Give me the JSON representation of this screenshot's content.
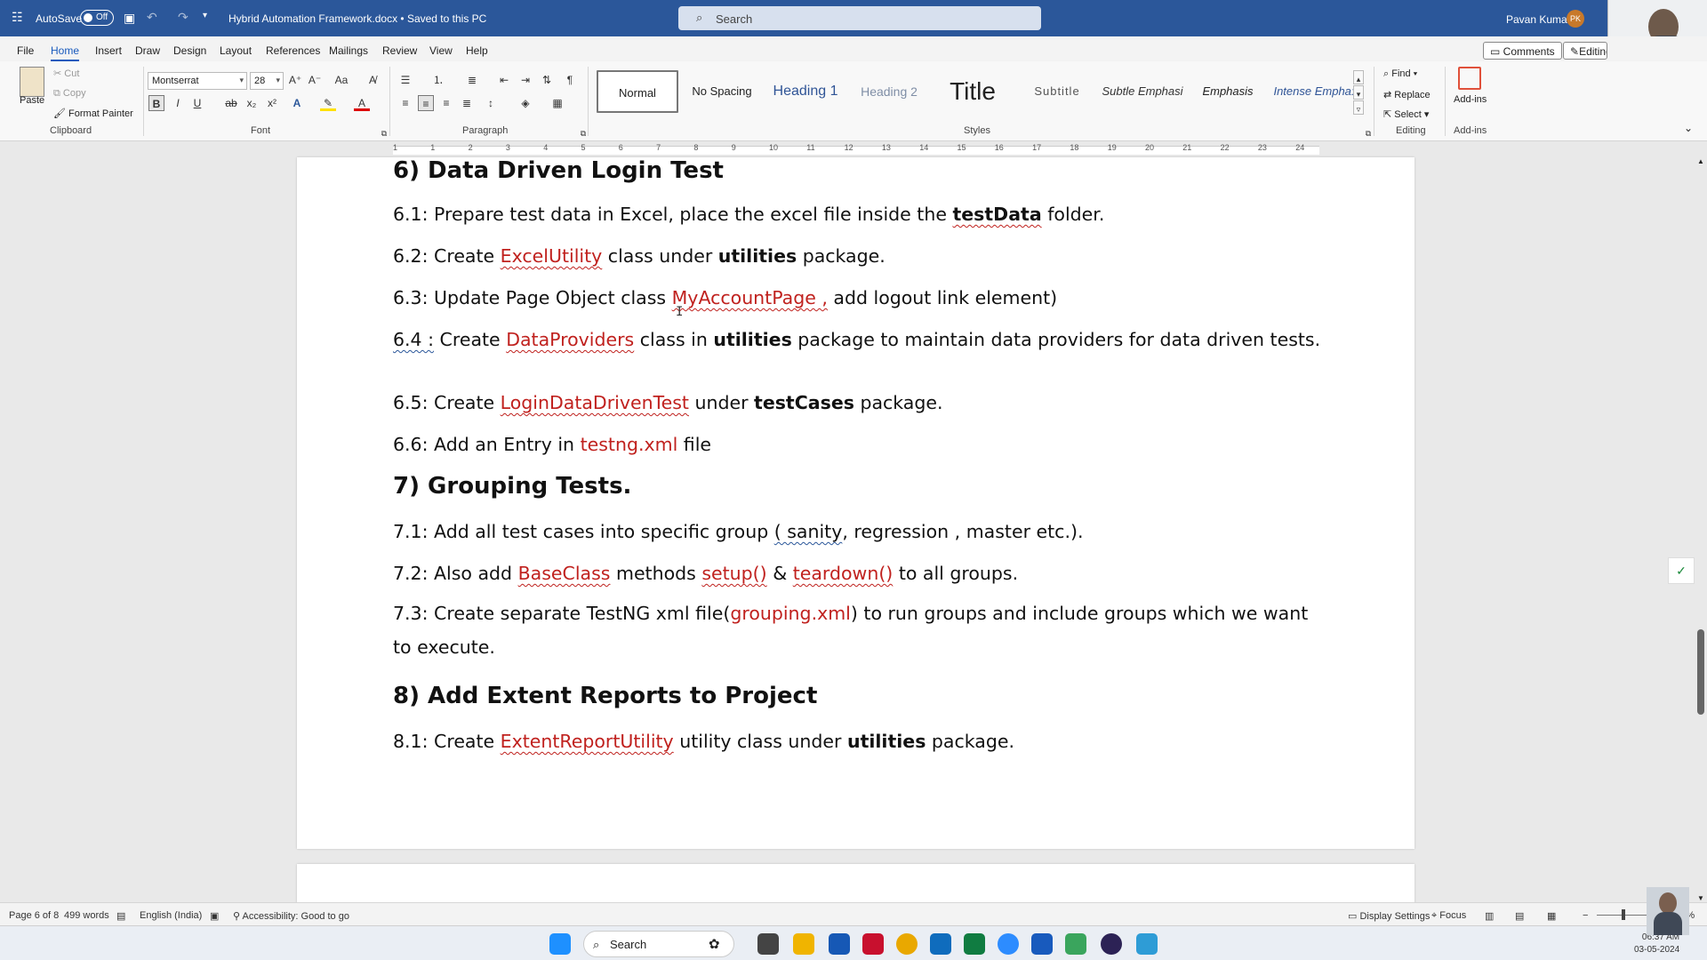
{
  "titlebar": {
    "autosave_label": "AutoSave",
    "autosave_state": "Off",
    "doc_title": "Hybrid Automation Framework.docx • Saved to this PC",
    "search_placeholder": "Search",
    "user_name": "Pavan Kumar",
    "user_initials": "PK"
  },
  "menu": {
    "items": [
      "File",
      "Home",
      "Insert",
      "Draw",
      "Design",
      "Layout",
      "References",
      "Mailings",
      "Review",
      "View",
      "Help"
    ],
    "active": "Home",
    "comments_label": "Comments",
    "editing_label": "Editing"
  },
  "ribbon": {
    "clipboard": {
      "paste": "Paste",
      "cut": "Cut",
      "copy": "Copy",
      "format_painter": "Format Painter",
      "group_label": "Clipboard"
    },
    "font": {
      "font_name": "Montserrat",
      "font_size": "28",
      "group_label": "Font"
    },
    "paragraph": {
      "group_label": "Paragraph"
    },
    "styles": {
      "items": [
        "Normal",
        "No Spacing",
        "Heading 1",
        "Heading 2",
        "Title",
        "Subtitle",
        "Subtle Emphasi",
        "Emphasis",
        "Intense Empha:"
      ],
      "selected": "Normal",
      "group_label": "Styles"
    },
    "editing": {
      "find": "Find",
      "replace": "Replace",
      "select": "Select",
      "group_label": "Editing"
    },
    "addins": {
      "label": "Add-ins",
      "group_label": "Add-ins"
    }
  },
  "ruler": {
    "ticks": [
      "1",
      "1",
      "2",
      "3",
      "4",
      "5",
      "6",
      "7",
      "8",
      "9",
      "10",
      "11",
      "12",
      "13",
      "14",
      "15",
      "16",
      "17",
      "18",
      "19",
      "20",
      "21",
      "22",
      "23",
      "24"
    ]
  },
  "document": {
    "h6": "6) Data Driven Login Test",
    "p61": {
      "pre": "6.1: Prepare test data in Excel, place the excel file inside the ",
      "bold": "testData",
      "post": " folder."
    },
    "p62": {
      "pre": "6.2: Create ",
      "red": "ExcelUtility",
      "mid": " class under ",
      "bold": "utilities",
      "post": " package."
    },
    "p63": {
      "pre": "6.3: Update Page Object class ",
      "red": "MyAccountPage ,",
      "post": " add logout link element)"
    },
    "p64": {
      "num": "6.4 :",
      "pre": " Create ",
      "red": "DataProviders",
      "mid": " class in ",
      "bold": "utilities",
      "post": " package to maintain data providers for data driven tests."
    },
    "p65": {
      "pre": "6.5: Create ",
      "red": "LoginDataDrivenTest",
      "mid": " under ",
      "bold": "testCases",
      "post": " package."
    },
    "p66": {
      "pre": "6.6: Add an Entry in ",
      "red": "testng.xml",
      "post": " file"
    },
    "h7": "7) Grouping Tests.",
    "p71": {
      "pre": "7.1: Add all test cases into specific group ",
      "sq": "( sanity",
      "post": ", regression , master etc.)."
    },
    "p72": {
      "pre": "7.2: Also add ",
      "red1": "BaseClass",
      "mid": " methods ",
      "red2": "setup()",
      "amp": " & ",
      "red3": "teardown()",
      "post": " to all groups."
    },
    "p73": {
      "pre": "7.3: Create separate TestNG xml file(",
      "red": "grouping.xml",
      "post": ") to run groups and include groups which we want to execute."
    },
    "h8": "8) Add Extent Reports to Project",
    "p81": {
      "pre": "8.1: Create ",
      "red": "ExtentReportUtility",
      "mid": " utility class under ",
      "bold": "utilities",
      "post": " package."
    }
  },
  "status": {
    "page": "Page 6 of 8",
    "words": "499 words",
    "language": "English (India)",
    "accessibility": "Accessibility: Good to go",
    "display_settings": "Display Settings",
    "focus": "Focus",
    "zoom": "128%"
  },
  "taskbar": {
    "search": "Search",
    "time": "06:37 AM",
    "date": "03-05-2024"
  },
  "colors": {
    "accent": "#2b579a",
    "link_red": "#c0211e"
  }
}
